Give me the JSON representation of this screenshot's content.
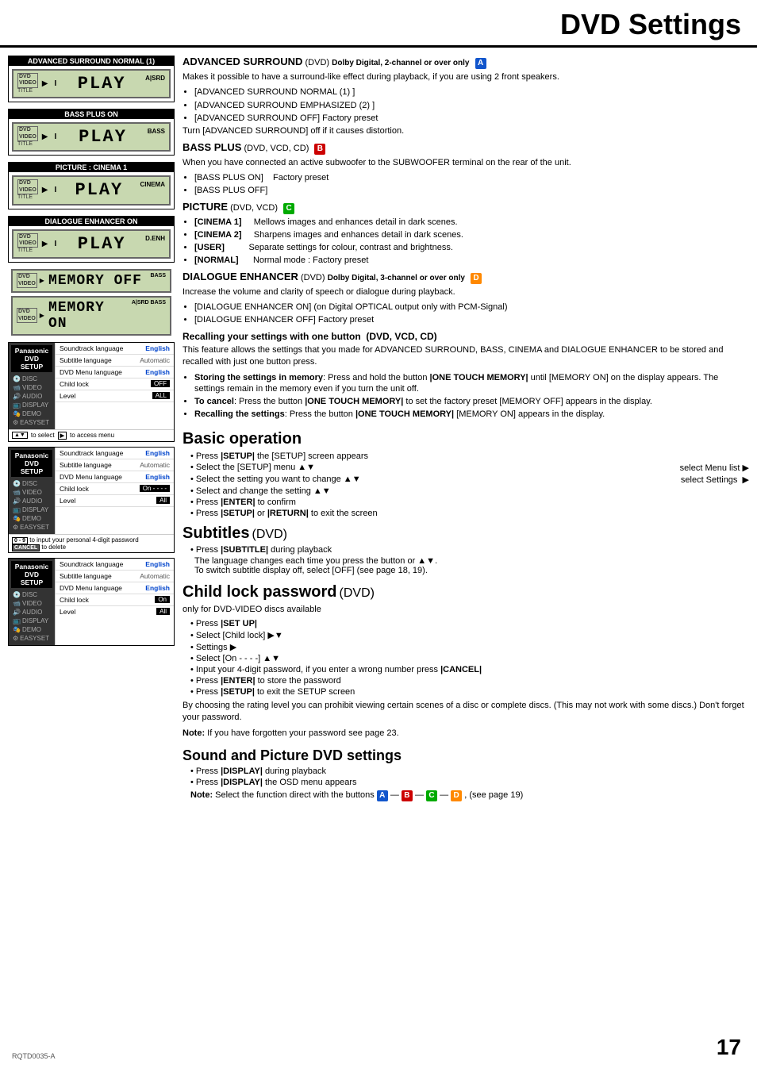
{
  "page": {
    "title": "DVD Settings",
    "page_number": "17",
    "rqtd": "RQTD0035-A"
  },
  "left": {
    "sections": [
      {
        "header": "ADVANCED SURROUND NORMAL (1)",
        "indicator": "A|SRD",
        "play_text": "PLAY",
        "dvd_label": "DVD VIDEO",
        "title": "TITLE",
        "arrow": "▶",
        "track": "I"
      },
      {
        "header": "BASS PLUS ON",
        "indicator": "BASS",
        "play_text": "PLAY",
        "dvd_label": "DVD VIDEO",
        "title": "TITLE",
        "arrow": "▶",
        "track": "I"
      },
      {
        "header": "PICTURE : CINEMA 1",
        "indicator": "CINEMA",
        "play_text": "PLAY",
        "dvd_label": "DVD VIDEO",
        "title": "TITLE",
        "arrow": "▶",
        "track": "I"
      },
      {
        "header": "DIALOGUE ENHANCER ON",
        "indicator": "D.ENH",
        "play_text": "PLAY",
        "dvd_label": "DVD VIDEO",
        "title": "TITLE",
        "arrow": "▶",
        "track": "I"
      }
    ],
    "memory_sections": [
      {
        "indicator": "BASS",
        "memory_text": "MEMORY OFF",
        "dvd_label": "DVD VIDEO",
        "arrow": "▶"
      },
      {
        "indicator": "A|SRD BASS",
        "memory_text": "MEMORY ON",
        "dvd_label": "DVD VIDEO",
        "arrow": "▶"
      }
    ],
    "setup_tables": [
      {
        "header_left": "Panasonic DVD SETUP",
        "rows": [
          {
            "label": "Soundtrack language",
            "value": "English",
            "value_class": "val-english"
          },
          {
            "label": "Subtitle language",
            "value": "Automatic",
            "value_class": "val-automatic"
          },
          {
            "label": "DVD Menu language",
            "value": "English",
            "value_class": "val-english"
          },
          {
            "label": "Child lock",
            "value": "OFF",
            "value_class": "val-box"
          },
          {
            "label": "Level",
            "value": "ALL",
            "value_class": "val-box"
          }
        ],
        "sidebar_items": [
          {
            "icon": "💿",
            "label": "DISC",
            "active": false
          },
          {
            "icon": "🎬",
            "label": "VIDEO",
            "active": false
          },
          {
            "icon": "🔊",
            "label": "AUDIO",
            "active": false
          },
          {
            "icon": "📺",
            "label": "DISPLAY",
            "active": false
          },
          {
            "icon": "🎭",
            "label": "DEMO",
            "active": false
          },
          {
            "icon": "⚙",
            "label": "EASYSET",
            "active": false
          }
        ],
        "nav_text1": "to select",
        "nav_text2": "to access menu"
      },
      {
        "header_left": "Panasonic DVD SETUP",
        "rows": [
          {
            "label": "Soundtrack language",
            "value": "English",
            "value_class": "val-english"
          },
          {
            "label": "Subtitle language",
            "value": "Automatic",
            "value_class": "val-automatic"
          },
          {
            "label": "DVD Menu language",
            "value": "English",
            "value_class": "val-english"
          },
          {
            "label": "Child lock",
            "value": "On - - - -",
            "value_class": "val-box"
          },
          {
            "label": "Level",
            "value": "All",
            "value_class": "val-box"
          }
        ],
        "sidebar_items": [
          {
            "icon": "💿",
            "label": "DISC",
            "active": false
          },
          {
            "icon": "🎬",
            "label": "VIDEO",
            "active": false
          },
          {
            "icon": "🔊",
            "label": "AUDIO",
            "active": false
          },
          {
            "icon": "📺",
            "label": "DISPLAY",
            "active": false
          },
          {
            "icon": "🎭",
            "label": "DEMO",
            "active": false
          },
          {
            "icon": "⚙",
            "label": "EASYSET",
            "active": false
          }
        ],
        "nav_text1": "0 - 9  to input your personal 4-digit password",
        "nav_text2": "CANCEL  to delete"
      },
      {
        "header_left": "Panasonic DVD SETUP",
        "rows": [
          {
            "label": "Soundtrack language",
            "value": "English",
            "value_class": "val-english"
          },
          {
            "label": "Subtitle language",
            "value": "Automatic",
            "value_class": "val-automatic"
          },
          {
            "label": "DVD Menu language",
            "value": "English",
            "value_class": "val-english"
          },
          {
            "label": "Child lock",
            "value": "On",
            "value_class": "val-box"
          },
          {
            "label": "Level",
            "value": "All",
            "value_class": "val-box"
          }
        ],
        "sidebar_items": [
          {
            "icon": "💿",
            "label": "DISC",
            "active": false
          },
          {
            "icon": "🎬",
            "label": "VIDEO",
            "active": false
          },
          {
            "icon": "🔊",
            "label": "AUDIO",
            "active": false
          },
          {
            "icon": "📺",
            "label": "DISPLAY",
            "active": false
          },
          {
            "icon": "🎭",
            "label": "DEMO",
            "active": false
          },
          {
            "icon": "⚙",
            "label": "EASYSET",
            "active": false
          }
        ],
        "nav_text1": "",
        "nav_text2": ""
      }
    ]
  },
  "right": {
    "advanced_surround": {
      "title": "ADVANCED SURROUND",
      "subtitle": "(DVD)",
      "qualifier": "Dolby Digital, 2-channel or over only",
      "badge": "A",
      "intro": "Makes it possible to have a surround-like effect during playback, if you are using 2 front speakers.",
      "bullets": [
        "[ADVANCED SURROUND NORMAL (1) ]",
        "[ADVANCED SURROUND EMPHASIZED (2) ]",
        "[ADVANCED SURROUND OFF] Factory preset"
      ],
      "note": "Turn [ADVANCED SURROUND] off if it causes distortion."
    },
    "bass_plus": {
      "title": "BASS PLUS",
      "subtitle": "(DVD, VCD, CD)",
      "badge": "B",
      "intro": "When you have connected an active subwoofer to the SUBWOOFER terminal on the rear of the unit.",
      "bullets": [
        "[BASS PLUS ON]    Factory preset",
        "[BASS PLUS OFF]"
      ]
    },
    "picture": {
      "title": "PICTURE",
      "subtitle": "(DVD, VCD)",
      "badge": "C",
      "rows": [
        {
          "label": "[CINEMA 1]",
          "desc": "Mellows images and enhances detail in dark scenes."
        },
        {
          "label": "[CINEMA 2]",
          "desc": "Sharpens images and enhances detail in dark scenes."
        },
        {
          "label": "[USER]",
          "desc": "Separate settings for colour, contrast and brightness."
        },
        {
          "label": "[NORMAL]",
          "desc": "Normal mode : Factory preset"
        }
      ]
    },
    "dialogue_enhancer": {
      "title": "DIALOGUE ENHANCER",
      "subtitle": "(DVD)",
      "qualifier": "Dolby Digital, 3-channel or over only",
      "badge": "D",
      "intro": "Increase the volume and clarity of speech or dialogue during playback.",
      "bullets": [
        "[DIALOGUE ENHANCER ON] (on Digital OPTICAL output only with PCM-Signal)",
        "[DIALOGUE ENHANCER OFF] Factory preset"
      ]
    },
    "recalling": {
      "title": "Recalling your settings with one button  (DVD, VCD, CD)",
      "intro": "This feature allows the settings that you made for ADVANCED SURROUND, BASS, CINEMA and DIALOGUE ENHANCER to be stored and recalled with just one button press.",
      "bullets": [
        {
          "bold_part": "Storing the settings in memory",
          "normal_part": ": Press and hold the button |ONE TOUCH MEMORY| until [MEMORY ON] on the display appears. The settings remain in the memory even if you turn the unit off."
        },
        {
          "bold_part": "To cancel",
          "normal_part": ": Press the button |ONE TOUCH MEMORY| to set the factory preset [MEMORY OFF] appears in the display."
        },
        {
          "bold_part": "Recalling the settings",
          "normal_part": ": Press the button |ONE TOUCH MEMORY| [MEMORY ON] appears in the display."
        }
      ]
    },
    "basic_operation": {
      "title": "Basic operation",
      "bullets": [
        {
          "text": "Press |SETUP| the [SETUP] screen appears",
          "right": ""
        },
        {
          "text": "Select the [SETUP] menu ▲▼",
          "right": "select Menu list ▶"
        },
        {
          "text": "Select the setting you want to change ▲▼",
          "right": "select Settings  ▶"
        },
        {
          "text": "Select and change the setting ▲▼",
          "right": ""
        },
        {
          "text": "Press |ENTER| to confirm",
          "right": ""
        },
        {
          "text": "Press |SETUP| or |RETURN| to exit the screen",
          "right": ""
        }
      ]
    },
    "subtitles": {
      "title": "Subtitles",
      "subtitle": "(DVD)",
      "bullets": [
        "Press |SUBTITLE| during playback"
      ],
      "extra": "The language changes each time you press the button or ▲▼. To switch subtitle display off, select [OFF] (see page 18, 19)."
    },
    "child_lock": {
      "title": "Child lock  password",
      "subtitle": "(DVD)",
      "intro": "only for DVD-VIDEO discs available",
      "bullets": [
        "Press |SET UP|",
        "Select [Child lock] ▶▼",
        "Settings ▶",
        "Select [On - - - -] ▲▼",
        "Input your 4-digit password, if you enter a wrong number press |CANCEL|",
        "Press |ENTER| to store the password",
        "Press |SETUP| to exit the SETUP screen"
      ],
      "extra1": "By choosing the rating level you can prohibit viewing certain scenes of a disc or complete discs. (This may not work with some discs.) Don't forget your password.",
      "extra2": "Note: If you have forgotten your password see page 23."
    },
    "sound_picture": {
      "title": "Sound and Picture DVD settings",
      "bullets": [
        "Press |DISPLAY| during playback",
        "Press |DISPLAY| the OSD menu appears"
      ],
      "note": "Note: Select the function direct with the buttons",
      "note_suffix": ", (see page 19)"
    }
  }
}
